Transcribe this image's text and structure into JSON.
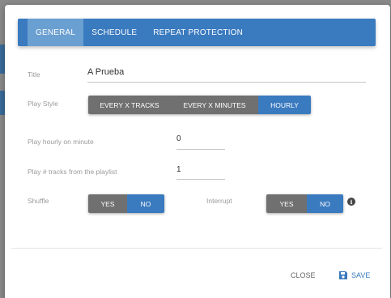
{
  "tabs": [
    {
      "label": "GENERAL",
      "active": true
    },
    {
      "label": "SCHEDULE",
      "active": false
    },
    {
      "label": "REPEAT PROTECTION",
      "active": false
    }
  ],
  "form": {
    "title_label": "Title",
    "title_value": "A Prueba",
    "play_style_label": "Play Style",
    "play_style_options": [
      "EVERY X TRACKS",
      "EVERY X MINUTES",
      "HOURLY"
    ],
    "play_style_selected": "HOURLY",
    "minute_label": "Play hourly on minute",
    "minute_value": "0",
    "tracks_label": "Play # tracks from the playlist",
    "tracks_value": "1",
    "shuffle_label": "Shuffle",
    "shuffle_yes": "YES",
    "shuffle_no": "NO",
    "shuffle_selected": "NO",
    "interrupt_label": "Interrupt",
    "interrupt_yes": "YES",
    "interrupt_no": "NO",
    "interrupt_selected": "NO",
    "info_icon": "info-icon"
  },
  "footer": {
    "close_label": "CLOSE",
    "save_label": "SAVE",
    "save_icon": "floppy-disk-icon"
  },
  "colors": {
    "accent": "#3a7abf",
    "tab_active": "#6a9fd1",
    "segment_off": "#707070",
    "backdrop": "#8a8a8a"
  }
}
